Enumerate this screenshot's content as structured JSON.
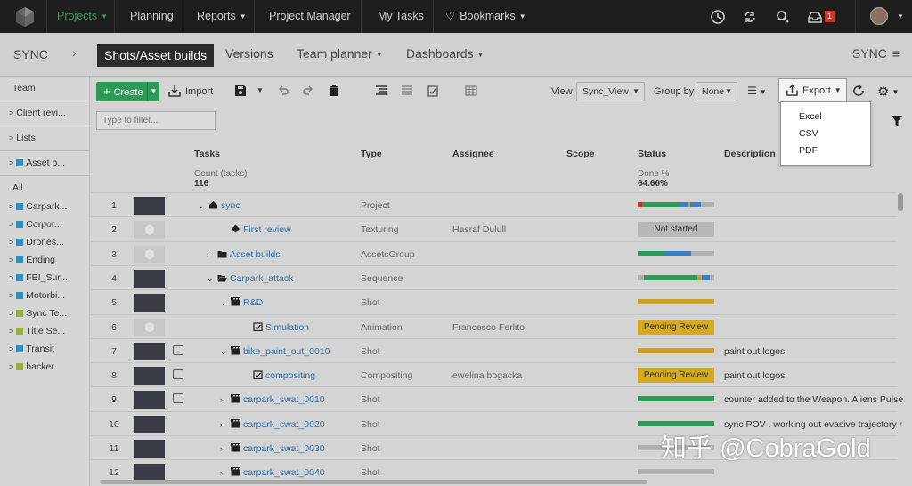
{
  "topnav": {
    "projects": "Projects",
    "planning": "Planning",
    "reports": "Reports",
    "project_manager": "Project Manager",
    "my_tasks": "My Tasks",
    "bookmarks": "Bookmarks",
    "notification_count": "1"
  },
  "subnav": {
    "project": "SYNC",
    "tabs": [
      "Shots/Asset builds",
      "Versions",
      "Team planner",
      "Dashboards"
    ],
    "right_label": "SYNC"
  },
  "sidebar": {
    "team": "Team",
    "client_review": "Client revi...",
    "lists": "Lists",
    "asset_builds": "Asset b...",
    "all": "All",
    "items": [
      {
        "label": "Carpark...",
        "color": "#2a8fbf"
      },
      {
        "label": "Corpor...",
        "color": "#2a8fbf"
      },
      {
        "label": "Drones...",
        "color": "#2a8fbf"
      },
      {
        "label": "Ending",
        "color": "#2a8fbf"
      },
      {
        "label": "FBI_Sur...",
        "color": "#2a8fbf"
      },
      {
        "label": "Motorbi...",
        "color": "#2a8fbf"
      },
      {
        "label": "Sync Te...",
        "color": "#8fb33a"
      },
      {
        "label": "Title Se...",
        "color": "#8fb33a"
      },
      {
        "label": "Transit",
        "color": "#2a8fbf"
      },
      {
        "label": "hacker",
        "color": "#8fb33a"
      }
    ]
  },
  "toolbar": {
    "create": "Create",
    "import": "Import",
    "view_label": "View",
    "view_value": "Sync_View",
    "group_by_label": "Group by",
    "group_by_value": "None",
    "export": "Export",
    "filter_placeholder": "Type to filter..."
  },
  "export_menu": [
    "Excel",
    "CSV",
    "PDF"
  ],
  "columns": {
    "tasks": "Tasks",
    "type": "Type",
    "assignee": "Assignee",
    "scope": "Scope",
    "status": "Status",
    "description": "Description"
  },
  "summary": {
    "count_label": "Count (tasks)",
    "count_value": "116",
    "done_label": "Done %",
    "done_value": "64.66%"
  },
  "rows": [
    {
      "num": "1",
      "name": "sync",
      "type": "Project",
      "assignee": "",
      "status": "",
      "desc": ""
    },
    {
      "num": "2",
      "name": "First review",
      "type": "Texturing",
      "assignee": "Hasraf Dulull",
      "status": "Not started",
      "desc": ""
    },
    {
      "num": "3",
      "name": "Asset builds",
      "type": "AssetsGroup",
      "assignee": "",
      "status": "",
      "desc": ""
    },
    {
      "num": "4",
      "name": "Carpark_attack",
      "type": "Sequence",
      "assignee": "",
      "status": "",
      "desc": ""
    },
    {
      "num": "5",
      "name": "R&D",
      "type": "Shot",
      "assignee": "",
      "status": "",
      "desc": ""
    },
    {
      "num": "6",
      "name": "Simulation",
      "type": "Animation",
      "assignee": "Francesco Ferlito",
      "status": "Pending Review",
      "desc": ""
    },
    {
      "num": "7",
      "name": "bike_paint_out_0010",
      "type": "Shot",
      "assignee": "",
      "status": "",
      "desc": "paint out logos"
    },
    {
      "num": "8",
      "name": "compositing",
      "type": "Compositing",
      "assignee": "ewelina bogacka",
      "status": "Pending Review",
      "desc": "paint out logos"
    },
    {
      "num": "9",
      "name": "carpark_swat_0010",
      "type": "Shot",
      "assignee": "",
      "status": "",
      "desc": "counter added to the Weapon.  Aliens Pulse"
    },
    {
      "num": "10",
      "name": "carpark_swat_0020",
      "type": "Shot",
      "assignee": "",
      "status": "",
      "desc": "sync POV . working out evasive trajectory r"
    },
    {
      "num": "11",
      "name": "carpark_swat_0030",
      "type": "Shot",
      "assignee": "",
      "status": "",
      "desc": ""
    },
    {
      "num": "12",
      "name": "carpark_swat_0040",
      "type": "Shot",
      "assignee": "",
      "status": "",
      "desc": ""
    }
  ],
  "watermark": "知乎 @CobraGold"
}
